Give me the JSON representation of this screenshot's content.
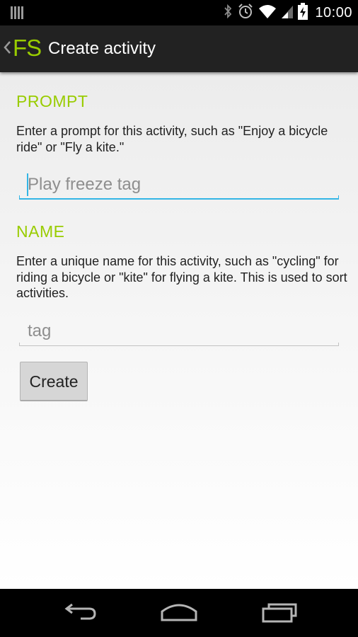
{
  "status_bar": {
    "time": "10:00",
    "icons": [
      "notification-icon",
      "bluetooth-icon",
      "alarm-icon",
      "wifi-icon",
      "signal-icon",
      "battery-charging-icon"
    ]
  },
  "action_bar": {
    "logo": "FS",
    "title": "Create activity",
    "logo_color": "#99cc00"
  },
  "prompt_section": {
    "header": "PROMPT",
    "hint": "Enter a prompt for this activity, such as \"Enjoy a bicycle ride\" or \"Fly a kite.\"",
    "field_placeholder": "Play freeze tag"
  },
  "name_section": {
    "header": "NAME",
    "hint": "Enter a unique name for this activity, such as \"cycling\" for riding a bicycle or \"kite\" for flying a kite. This is used to sort activities.",
    "field_placeholder": "tag"
  },
  "create_button": {
    "label": "Create"
  },
  "nav_bar": {
    "icons": [
      "back-icon",
      "home-icon",
      "recent-apps-icon"
    ]
  },
  "colors": {
    "accent": "#99cc00",
    "focus": "#33b5e5"
  }
}
